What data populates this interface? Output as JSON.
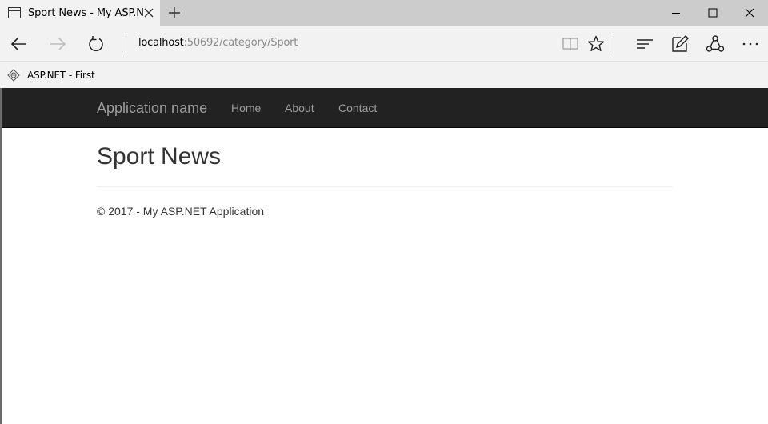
{
  "browser": {
    "tab_title": "Sport News - My ASP.N",
    "url_host": "localhost",
    "url_path": ":50692/category/Sport",
    "favorites": [
      {
        "label": "ASP.NET - First"
      }
    ]
  },
  "site": {
    "brand": "Application name",
    "nav": {
      "home": "Home",
      "about": "About",
      "contact": "Contact"
    }
  },
  "main": {
    "title": "Sport News"
  },
  "footer": {
    "text": "© 2017 - My ASP.NET Application"
  },
  "colors": {
    "navbar_bg": "#222222",
    "nav_text": "#9d9d9d",
    "chrome_bg": "#f2f2f2",
    "titlebar_bg": "#cccccc"
  },
  "icons": {
    "tab": "page-icon",
    "tab_close": "close-icon",
    "new_tab": "plus-icon",
    "back": "arrow-left-icon",
    "forward": "arrow-right-icon",
    "refresh": "refresh-icon",
    "reading_view": "book-icon",
    "favorite": "star-icon",
    "hub": "hub-icon",
    "web_note": "pen-icon",
    "share": "share-icon",
    "more": "more-icon",
    "minimize": "minimize-icon",
    "maximize": "maximize-icon",
    "close_window": "close-window-icon",
    "favorite_site": "site-icon"
  }
}
